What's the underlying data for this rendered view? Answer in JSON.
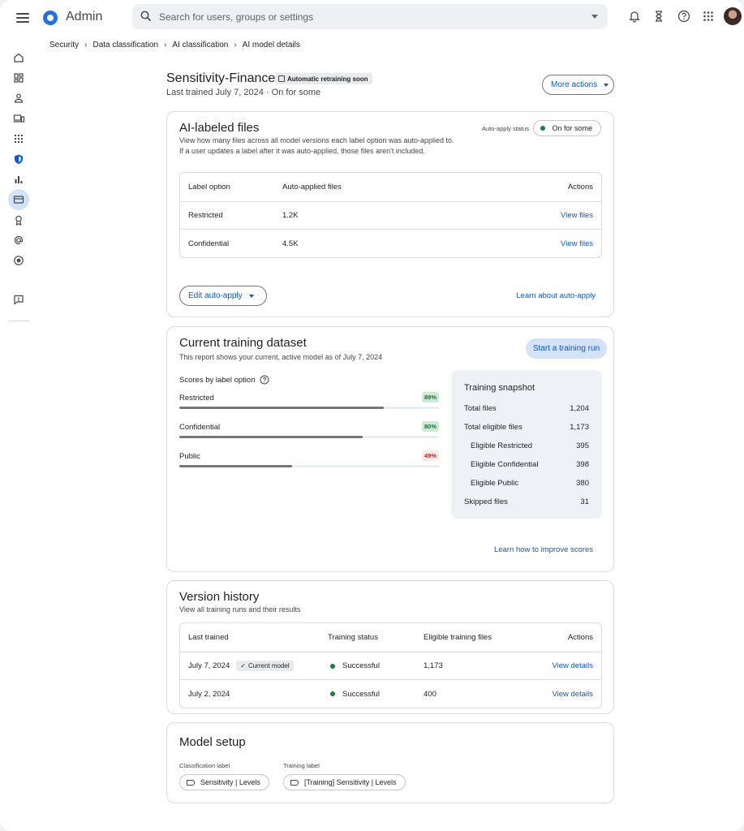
{
  "app": {
    "title": "Admin"
  },
  "search": {
    "placeholder": "Search for users, groups or settings"
  },
  "breadcrumb": [
    "Security",
    "Data classification",
    "AI classification",
    "AI model details"
  ],
  "header": {
    "title": "Sensitivity-Finance",
    "badge": "Automatic retraining soon",
    "subtitle": "Last trained July 7, 2024 · On for some",
    "more_actions": "More actions"
  },
  "ai_labeled": {
    "title": "AI-labeled files",
    "desc_line1": "View how many files across all model versions each label option was auto-applied to.",
    "desc_line2": "If a user updates a label after it was auto-applied, those files aren't included.",
    "status_label": "Auto-apply status",
    "status_value": "On for some",
    "columns": [
      "Label option",
      "Auto-applied files",
      "Actions"
    ],
    "rows": [
      {
        "label": "Restricted",
        "files": "1.2K",
        "action": "View files"
      },
      {
        "label": "Confidential",
        "files": "4.5K",
        "action": "View files"
      }
    ],
    "edit_button": "Edit auto-apply",
    "learn_link": "Learn about auto-apply"
  },
  "training": {
    "title": "Current training dataset",
    "desc": "This report shows your current, active model as of July 7, 2024",
    "start_button": "Start a training run",
    "scores_heading": "Scores by label option",
    "scores": [
      {
        "name": "Restricted",
        "value": 89,
        "label": "89%",
        "status": "good"
      },
      {
        "name": "Confidential",
        "value": 80,
        "label": "80%",
        "status": "good"
      },
      {
        "name": "Public",
        "value": 49,
        "label": "49%",
        "status": "bad"
      }
    ],
    "snapshot": {
      "title": "Training snapshot",
      "rows": [
        {
          "label": "Total files",
          "value": "1,204",
          "indent": false
        },
        {
          "label": "Total eligible files",
          "value": "1,173",
          "indent": false
        },
        {
          "label": "Eligible Restricted",
          "value": "395",
          "indent": true
        },
        {
          "label": "Eligible Confidential",
          "value": "398",
          "indent": true
        },
        {
          "label": "Eligible Public",
          "value": "380",
          "indent": true
        },
        {
          "label": "Skipped files",
          "value": "31",
          "indent": false
        }
      ]
    },
    "improve_link": "Learn how to improve scores"
  },
  "versions": {
    "title": "Version history",
    "desc": "View all training runs and their results",
    "columns": [
      "Last trained",
      "Training status",
      "Eligible training files",
      "Actions"
    ],
    "rows": [
      {
        "date": "July 7, 2024",
        "current": "Current model",
        "status": "Successful",
        "files": "1,173",
        "action": "View details"
      },
      {
        "date": "July 2, 2024",
        "current": "",
        "status": "Successful",
        "files": "400",
        "action": "View details"
      }
    ]
  },
  "setup": {
    "title": "Model setup",
    "classification_label": "Classification label",
    "classification_value": "Sensitivity | Levels",
    "training_label": "Training label",
    "training_value": "[Training] Sensitivity | Levels"
  },
  "colors": {
    "accent": "#0b57d0",
    "success": "#188038",
    "good_bg": "#ceead6",
    "good_fg": "#137333",
    "bad_bg": "#fce8e6",
    "bad_fg": "#c5221f"
  },
  "icons": {
    "topbar": [
      "menu-icon",
      "admin-logo-icon",
      "search-icon",
      "notifications-icon",
      "hourglass-icon",
      "help-icon",
      "apps-icon",
      "avatar"
    ],
    "sidebar": [
      "home-icon",
      "dashboard-icon",
      "user-icon",
      "devices-icon",
      "apps-grid-icon",
      "security-shield-icon",
      "reporting-icon",
      "billing-icon",
      "rules-icon",
      "account-icon",
      "directory-icon",
      "feedback-icon"
    ]
  }
}
